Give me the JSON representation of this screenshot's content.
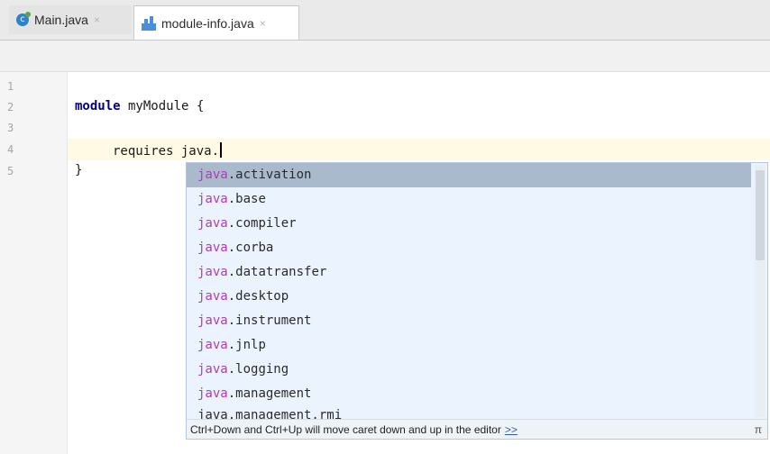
{
  "tabs": [
    {
      "label": "Main.java",
      "icon": "java-class-icon",
      "close": "×",
      "active": false
    },
    {
      "label": "module-info.java",
      "icon": "module-info-icon",
      "close": "×",
      "active": true
    }
  ],
  "gutter": {
    "line_numbers": [
      "1",
      "2",
      "3",
      "4",
      "5"
    ]
  },
  "code": {
    "line2_keyword": "module",
    "line2_rest": " myModule {",
    "line4_text": "requires java.",
    "line5_text": "}"
  },
  "completion": {
    "prefix": "java",
    "items": [
      "activation",
      "base",
      "compiler",
      "corba",
      "datatransfer",
      "desktop",
      "instrument",
      "jnlp",
      "logging",
      "management"
    ],
    "partial_item": "java.management.rmi",
    "selected_index": 0,
    "hint_text": "Ctrl+Down and Ctrl+Up will move caret down and up in the editor",
    "hint_link": ">>",
    "pi_symbol": "π"
  },
  "colors": {
    "keyword": "#000080",
    "prefix_match": "#b03bb5",
    "selection": "#a9bacc",
    "popup_bg": "#ebf4fe",
    "current_line": "#fffae3"
  }
}
